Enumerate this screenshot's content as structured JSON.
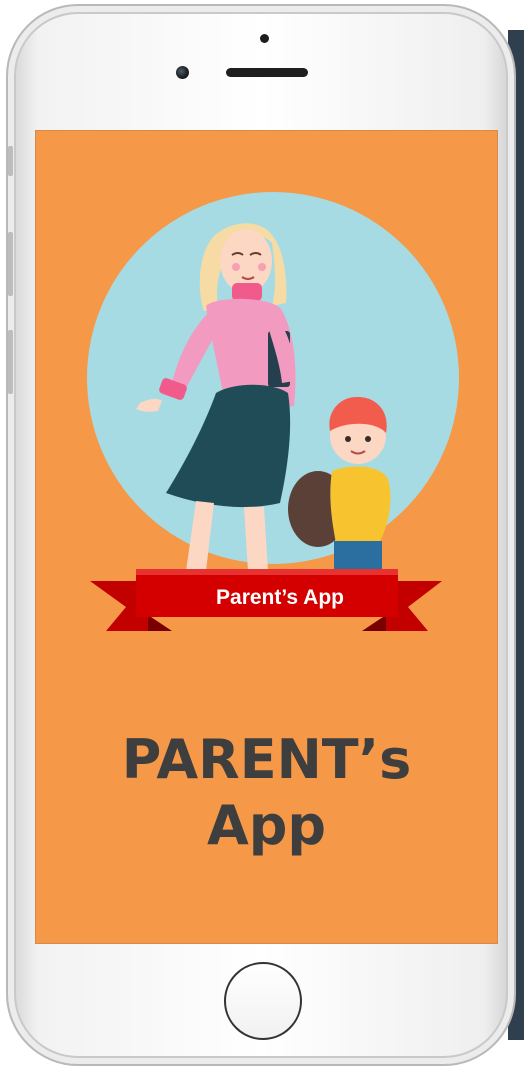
{
  "ribbon": {
    "label": "Parent’s App"
  },
  "title": {
    "line1": "PARENT’s",
    "line2": "App"
  },
  "colors": {
    "screen_background": "#f59848",
    "circle_background": "#a6dbe3",
    "ribbon_red": "#d40000",
    "title_text": "#3e3e3e"
  },
  "illustration": {
    "subjects": [
      "woman-figure",
      "boy-with-backpack"
    ]
  }
}
